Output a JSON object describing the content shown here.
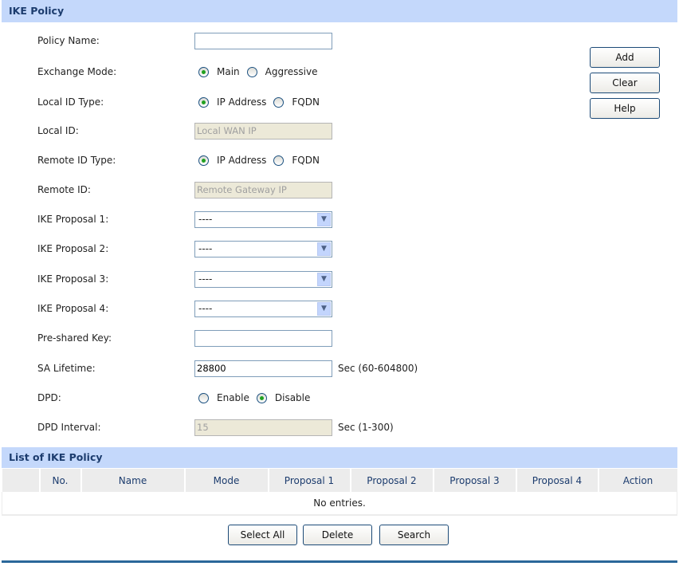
{
  "section_title": "IKE Policy",
  "form": {
    "policy_name": {
      "label": "Policy Name:",
      "value": ""
    },
    "exchange_mode": {
      "label": "Exchange Mode:",
      "options": [
        "Main",
        "Aggressive"
      ],
      "selected": "Main"
    },
    "local_id_type": {
      "label": "Local ID Type:",
      "options": [
        "IP Address",
        "FQDN"
      ],
      "selected": "IP Address"
    },
    "local_id": {
      "label": "Local ID:",
      "value": "Local WAN IP"
    },
    "remote_id_type": {
      "label": "Remote ID Type:",
      "options": [
        "IP Address",
        "FQDN"
      ],
      "selected": "IP Address"
    },
    "remote_id": {
      "label": "Remote ID:",
      "value": "Remote Gateway IP"
    },
    "proposals": [
      {
        "label": "IKE Proposal 1:",
        "value": "----"
      },
      {
        "label": "IKE Proposal 2:",
        "value": "----"
      },
      {
        "label": "IKE Proposal 3:",
        "value": "----"
      },
      {
        "label": "IKE Proposal 4:",
        "value": "----"
      }
    ],
    "psk": {
      "label": "Pre-shared Key:",
      "value": ""
    },
    "sa_lifetime": {
      "label": "SA Lifetime:",
      "value": "28800",
      "suffix": "Sec (60-604800)"
    },
    "dpd": {
      "label": "DPD:",
      "options": [
        "Enable",
        "Disable"
      ],
      "selected": "Disable"
    },
    "dpd_interval": {
      "label": "DPD Interval:",
      "value": "15",
      "suffix": "Sec (1-300)"
    }
  },
  "side_buttons": {
    "add": "Add",
    "clear": "Clear",
    "help": "Help"
  },
  "list": {
    "title": "List of IKE Policy",
    "columns": [
      "",
      "No.",
      "Name",
      "Mode",
      "Proposal 1",
      "Proposal 2",
      "Proposal 3",
      "Proposal 4",
      "Action"
    ],
    "empty": "No entries."
  },
  "list_buttons": {
    "select_all": "Select All",
    "delete": "Delete",
    "search": "Search"
  }
}
